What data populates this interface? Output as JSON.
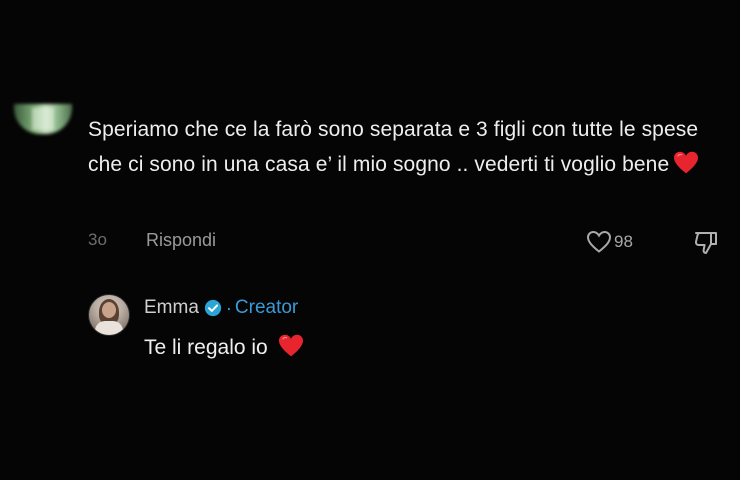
{
  "comment": {
    "text": "Speriamo che ce la farò sono separata e 3 figli con tutte le spese che ci sono in una casa e’ il mio sogno .. vederti ti voglio bene",
    "emoji": "red-heart-emoji",
    "timestamp": "3o",
    "reply_label": "Rispondi",
    "like_count": "98"
  },
  "reply": {
    "author": "Emma",
    "separator": "·",
    "author_badge": "Creator",
    "text": "Te li regalo io",
    "emoji": "red-heart-emoji"
  },
  "colors": {
    "background": "#050505",
    "text": "#eeeeee",
    "muted": "#9a9a9a",
    "creator_accent": "#3b9ad6",
    "heart": "#e8242f"
  }
}
